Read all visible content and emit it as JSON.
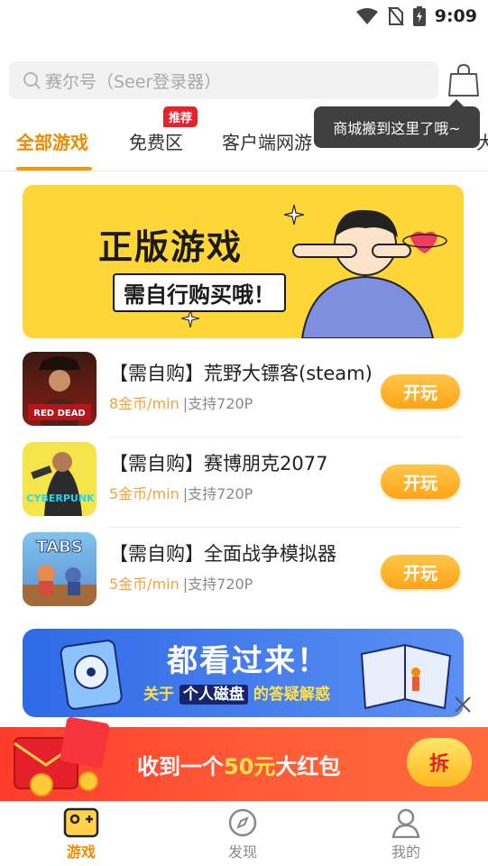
{
  "status_bar": {
    "time": "9:09"
  },
  "search": {
    "placeholder": "赛尔号（Seer登录器）"
  },
  "tooltip": {
    "text": "商城搬到这里了哦~"
  },
  "tabs": [
    {
      "label": "全部游戏",
      "active": true
    },
    {
      "label": "免费区",
      "badge": "推荐"
    },
    {
      "label": "客户端网游"
    },
    {
      "label": "大"
    }
  ],
  "promo_banner": {
    "title": "正版游戏",
    "subtitle": "需自行购买哦！"
  },
  "games": [
    {
      "title": "【需自购】荒野大镖客(steam)",
      "price": "8金币/min",
      "resolution": "|支持720P",
      "play_label": "开玩",
      "icon": "red-dead-redemption-2-icon"
    },
    {
      "title": "【需自购】赛博朋克2077",
      "price": "5金币/min",
      "resolution": "|支持720P",
      "play_label": "开玩",
      "icon": "cyberpunk-2077-icon"
    },
    {
      "title": "【需自购】全面战争模拟器",
      "price": "5金币/min",
      "resolution": "|支持720P",
      "play_label": "开玩",
      "icon": "tabs-icon"
    }
  ],
  "disk_banner": {
    "title": "都看过来！",
    "sub_prefix": "关于",
    "sub_highlight": "个人磁盘",
    "sub_suffix": "的答疑解惑"
  },
  "red_packet": {
    "prefix": "收到一个",
    "amount": "50元",
    "suffix": "大红包",
    "button": "拆"
  },
  "bottom_nav": [
    {
      "label": "游戏",
      "active": true,
      "icon": "gamepad-icon"
    },
    {
      "label": "发现",
      "icon": "compass-icon"
    },
    {
      "label": "我的",
      "icon": "profile-icon"
    }
  ],
  "colors": {
    "accent": "#f08a00",
    "badge": "#e9212b",
    "price": "#f3a13a",
    "banner_yellow": "#ffd637",
    "banner_blue": "#2f6ae7",
    "red_bar": "#ff3b2b"
  }
}
